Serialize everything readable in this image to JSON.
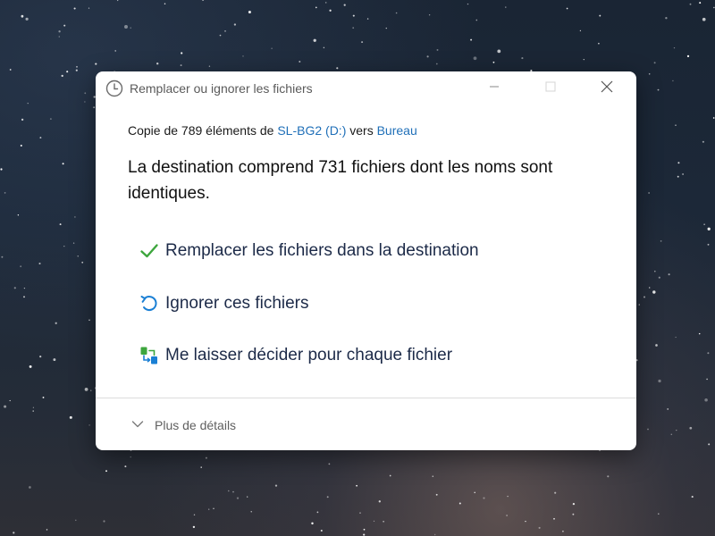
{
  "dialog": {
    "title": "Remplacer ou ignorer les fichiers",
    "app_icon": "clock-icon",
    "controls": {
      "minimize_icon": "minimize-icon",
      "maximize_icon": "maximize-icon",
      "close_icon": "close-icon"
    },
    "info": {
      "prefix": "Copie de 789 éléments de ",
      "source": "SL-BG2 (D:)",
      "middle": " vers ",
      "destination": "Bureau"
    },
    "headline": "La destination comprend 731 fichiers dont les noms sont identiques.",
    "options": [
      {
        "label": "Remplacer les fichiers dans la destination",
        "icon": "checkmark-icon"
      },
      {
        "label": "Ignorer ces fichiers",
        "icon": "undo-arrow-icon"
      },
      {
        "label": "Me laisser décider pour chaque fichier",
        "icon": "compare-files-icon"
      }
    ],
    "details_label": "Plus de détails",
    "details_icon": "chevron-down-icon"
  },
  "colors": {
    "link": "#1f6fb8",
    "check_green": "#3da63d",
    "undo_blue": "#1a7fd4",
    "option_text": "#1c2a48"
  }
}
